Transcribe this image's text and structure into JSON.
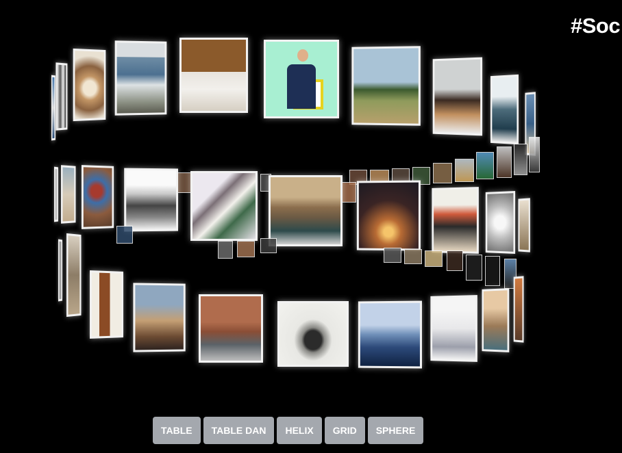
{
  "header": {
    "title": "#Soc"
  },
  "view": {
    "active_layout": "helix",
    "gallery_label": "photo-gallery"
  },
  "menu": {
    "buttons": [
      {
        "id": "table",
        "label": "TABLE"
      },
      {
        "id": "table-dan",
        "label": "TABLE DAN"
      },
      {
        "id": "helix",
        "label": "HELIX"
      },
      {
        "id": "grid",
        "label": "GRID"
      },
      {
        "id": "sphere",
        "label": "SPHERE"
      }
    ]
  },
  "colors": {
    "background": "#000000",
    "button_bg": "#c8cdd4",
    "button_text": "#ffffff",
    "title_text": "#ffffff"
  }
}
